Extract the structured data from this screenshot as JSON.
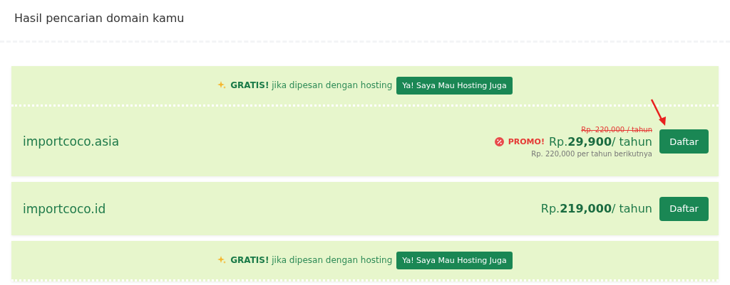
{
  "title": "Hasil pencarian domain kamu",
  "panels": [
    {
      "kind": "promo_domain",
      "banner": {
        "label": "GRATIS!",
        "text": "jika dipesan dengan hosting",
        "button": "Ya! Saya Mau Hosting Juga"
      },
      "domain": "importcoco.asia",
      "old_price": "Rp. 220,000 / tahun",
      "promo_label": "PROMO!",
      "price": "Rp.**29,900**/ tahun",
      "renewal": "Rp. 220,000 per tahun berikutnya",
      "button": "Daftar",
      "pointer_arrow": true
    },
    {
      "kind": "domain",
      "domain": "importcoco.id",
      "price": "Rp.**219,000**/ tahun",
      "button": "Daftar",
      "pointer_arrow": false
    },
    {
      "kind": "banner",
      "banner": {
        "label": "GRATIS!",
        "text": "jika dipesan dengan hosting",
        "button": "Ya! Saya Mau Hosting Juga"
      }
    }
  ]
}
